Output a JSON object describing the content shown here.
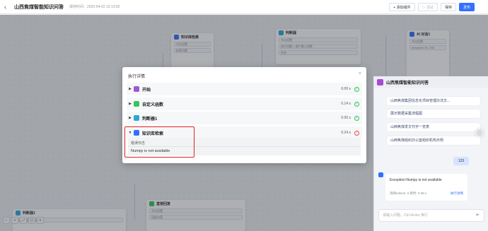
{
  "header": {
    "back_icon": "‹",
    "title": "山西焦煤智能知识问答",
    "save_time": "保存时间：2025-04-03 15:10:50",
    "add_component": "+ 添加组件",
    "debug": "▷ 调试",
    "save": "保存",
    "publish": "发布"
  },
  "canvas_nodes": {
    "kb_search_top": {
      "title": "知识库检索",
      "sub": "节点设置",
      "field": "检索问题"
    },
    "condition_top": {
      "title": "判断器",
      "sub": "节点设置",
      "field": "执行问题 = 用户输入问题",
      "op": "包含"
    },
    "ai_chat": {
      "title": "AI 对话1",
      "sub": "节点设置",
      "model": "deepseek-R1 70B"
    },
    "condition_bottom": {
      "title": "判断器1",
      "row": "自定义函数 > 结果"
    },
    "direct_reply": {
      "title": "直接回复",
      "sub": "节点设置",
      "row": "回复内容"
    }
  },
  "modal": {
    "title": "执行详情",
    "close_icon": "×",
    "steps": [
      {
        "label": "开始",
        "time": "0.00 s",
        "status": "success",
        "color": "#9b59d0"
      },
      {
        "label": "自定义函数",
        "time": "0.14 s",
        "status": "success",
        "color": "#34c759"
      },
      {
        "label": "判断器1",
        "time": "0.00 s",
        "status": "success",
        "color": "#2aa8d8"
      },
      {
        "label": "知识库检索",
        "time": "0.24 s",
        "status": "error",
        "color": "#3370ff"
      }
    ],
    "error": {
      "heading": "错误日志",
      "message": "Numpy is not available"
    }
  },
  "chat": {
    "title": "山西焦煤智能知识问答",
    "questions": [
      "山西焦煤集团信息化项目管理办法文...",
      "展示数据采集流程图",
      "山西焦煤发文代字一览表",
      "山西焦煤组织办公室组织机构示例"
    ],
    "user_message": "123",
    "answer": {
      "text": "Exception:Numpy is not available",
      "meta": "消耗tokens: 0  耗时: 0.39 s",
      "link": "执行详情"
    },
    "input_placeholder": "请输入问题，Ctrl+Enter 换行",
    "send_icon": "➤"
  },
  "toolbar": {
    "zoom_out": "−",
    "zoom_in": "+",
    "fit": "⤢",
    "lock": "▢",
    "layout": "≡"
  }
}
